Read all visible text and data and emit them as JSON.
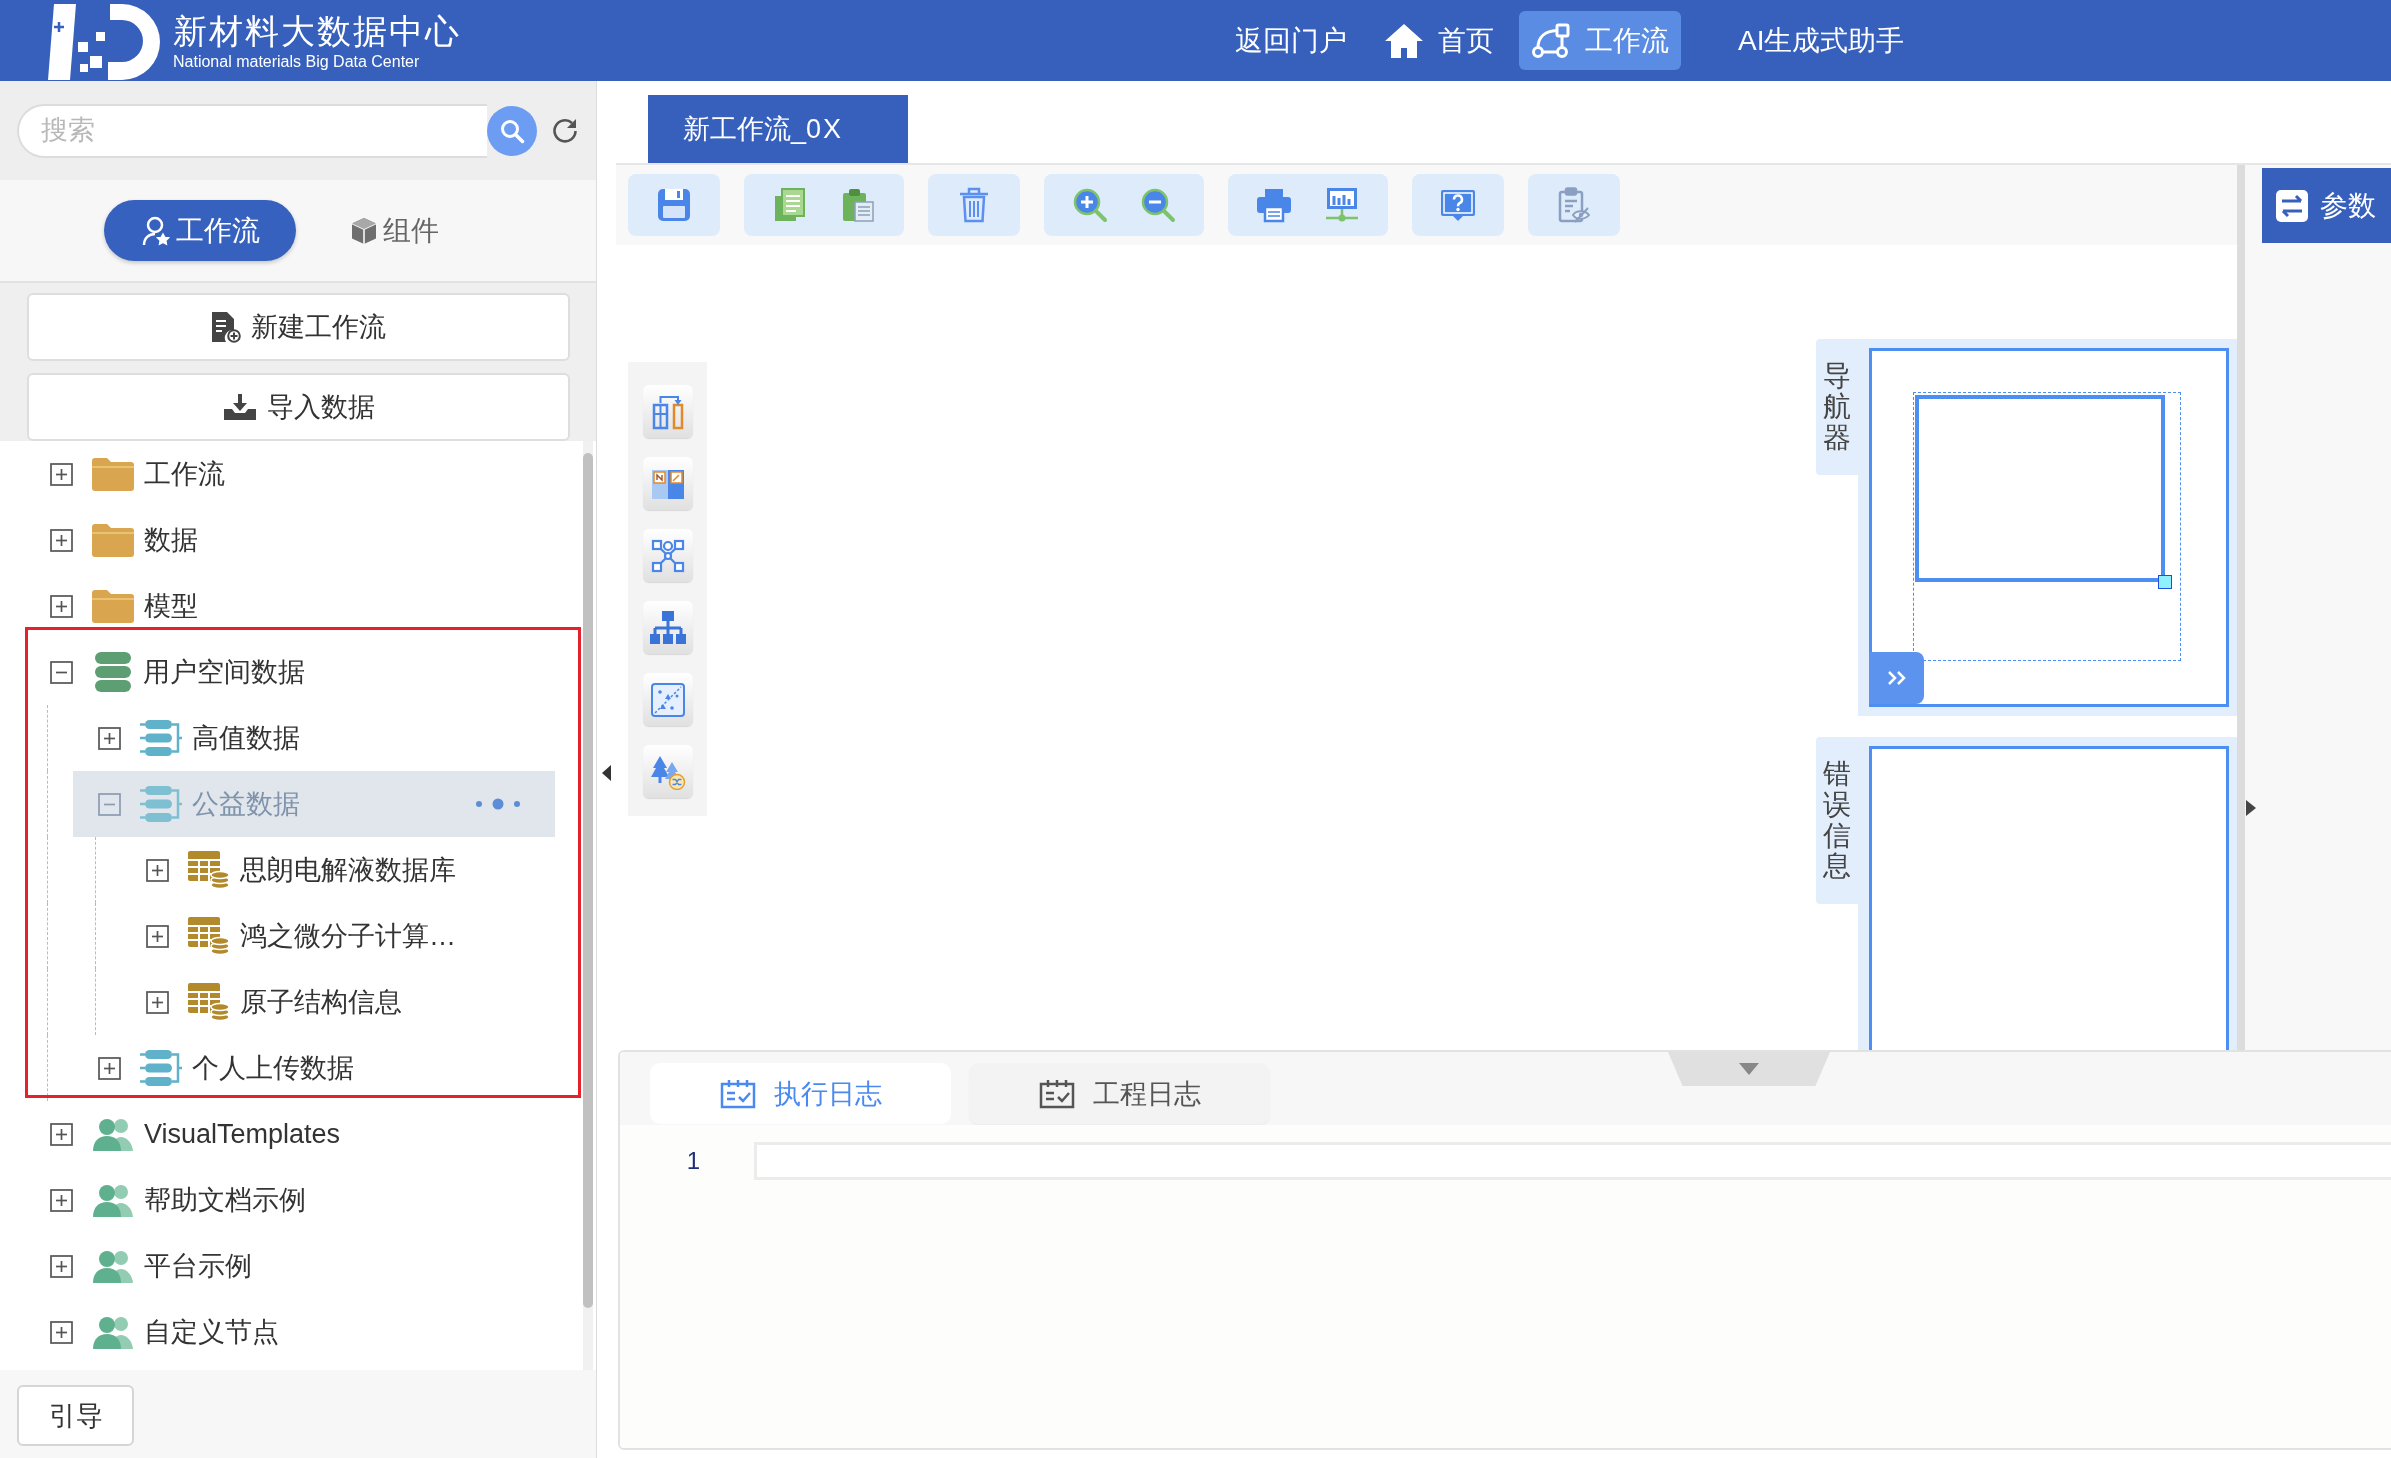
{
  "header": {
    "title": "新材料大数据中心",
    "subtitle": "National materials Big Data Center",
    "nav": [
      {
        "label": "返回门户",
        "kind": "text",
        "selected": false
      },
      {
        "label": "首页",
        "kind": "home",
        "selected": false
      },
      {
        "label": "工作流",
        "kind": "flow",
        "selected": true
      },
      {
        "label": "AI生成式助手",
        "kind": "text",
        "selected": false
      }
    ]
  },
  "sidebar": {
    "search": {
      "placeholder": "搜索"
    },
    "tabs": [
      {
        "label": "工作流",
        "kind": "user",
        "selected": true
      },
      {
        "label": "组件",
        "kind": "cube",
        "selected": false
      }
    ],
    "actions": [
      {
        "label": "新建工作流",
        "kind": "new"
      },
      {
        "label": "导入数据",
        "kind": "import"
      }
    ],
    "tree": [
      {
        "label": "工作流",
        "kind": "folder",
        "expanded": false,
        "selected": false,
        "highlighted": false
      },
      {
        "label": "数据",
        "kind": "folder",
        "expanded": false,
        "selected": false,
        "highlighted": false
      },
      {
        "label": "模型",
        "kind": "folder",
        "expanded": false,
        "selected": false,
        "highlighted": false
      },
      {
        "label": "用户空间数据",
        "kind": "database",
        "expanded": true,
        "selected": false,
        "highlighted": true,
        "children": [
          {
            "label": "高值数据",
            "kind": "dataset",
            "expanded": false,
            "selected": false
          },
          {
            "label": "公益数据",
            "kind": "dataset",
            "expanded": true,
            "selected": true,
            "children": [
              {
                "label": "思朗电解液数据库",
                "kind": "table",
                "expanded": false,
                "selected": false
              },
              {
                "label": "鸿之微分子计算…",
                "kind": "table",
                "expanded": false,
                "selected": false
              },
              {
                "label": "原子结构信息",
                "kind": "table",
                "expanded": false,
                "selected": false
              }
            ]
          },
          {
            "label": "个人上传数据",
            "kind": "dataset",
            "expanded": false,
            "selected": false
          }
        ]
      },
      {
        "label": "VisualTemplates",
        "kind": "users",
        "expanded": false,
        "selected": false,
        "highlighted": false
      },
      {
        "label": "帮助文档示例",
        "kind": "users",
        "expanded": false,
        "selected": false,
        "highlighted": false
      },
      {
        "label": "平台示例",
        "kind": "users",
        "expanded": false,
        "selected": false,
        "highlighted": false
      },
      {
        "label": "自定义节点",
        "kind": "users",
        "expanded": false,
        "selected": false,
        "highlighted": false
      }
    ],
    "guide_button": "引导"
  },
  "editor": {
    "tabs": [
      {
        "label": "新工作流_0",
        "close": "X",
        "selected": true
      }
    ]
  },
  "canvas": {
    "panels": [
      {
        "label": "导航器",
        "kind": "navigator"
      },
      {
        "label": "错误信息",
        "kind": "errors"
      }
    ]
  },
  "right_panel": {
    "tab": "参数"
  },
  "log": {
    "tabs": [
      {
        "label": "执行日志",
        "selected": true
      },
      {
        "label": "工程日志",
        "selected": false
      }
    ],
    "lines": [
      {
        "number": "1"
      }
    ]
  }
}
